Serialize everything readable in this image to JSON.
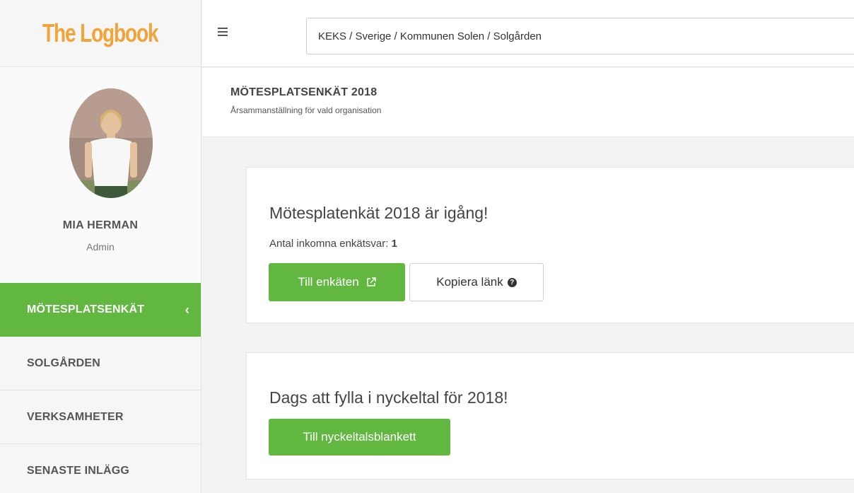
{
  "app": {
    "logo_text": "The Logbook"
  },
  "header": {
    "breadcrumb": "KEKS / Sverige / Kommunen Solen / Solgården"
  },
  "user": {
    "name": "MIA HERMAN",
    "role": "Admin"
  },
  "sidebar": {
    "items": [
      {
        "label": "MÖTESPLATSENKÄT",
        "active": true
      },
      {
        "label": "SOLGÅRDEN"
      },
      {
        "label": "VERKSAMHETER"
      },
      {
        "label": "SENASTE INLÄGG"
      }
    ]
  },
  "page": {
    "title": "MÖTESPLATSENKÄT 2018",
    "subtitle": "Årsammanställning för vald organisation"
  },
  "survey_card": {
    "heading": "Mötesplatenkät 2018 är igång!",
    "count_label": "Antal inkomna enkätsvar: ",
    "count_value": "1",
    "open_button": "Till enkäten",
    "copy_button": "Kopiera länk"
  },
  "kpi_card": {
    "heading": "Dags att fylla i nyckeltal för 2018!",
    "button": "Till nyckeltalsblankett"
  },
  "colors": {
    "brand_orange": "#f2a33a",
    "accent_green": "#62b741"
  },
  "icons": {
    "menu": "hamburger-icon",
    "external": "external-link-icon",
    "help": "question-circle-icon",
    "collapse": "chevron-left-icon"
  }
}
